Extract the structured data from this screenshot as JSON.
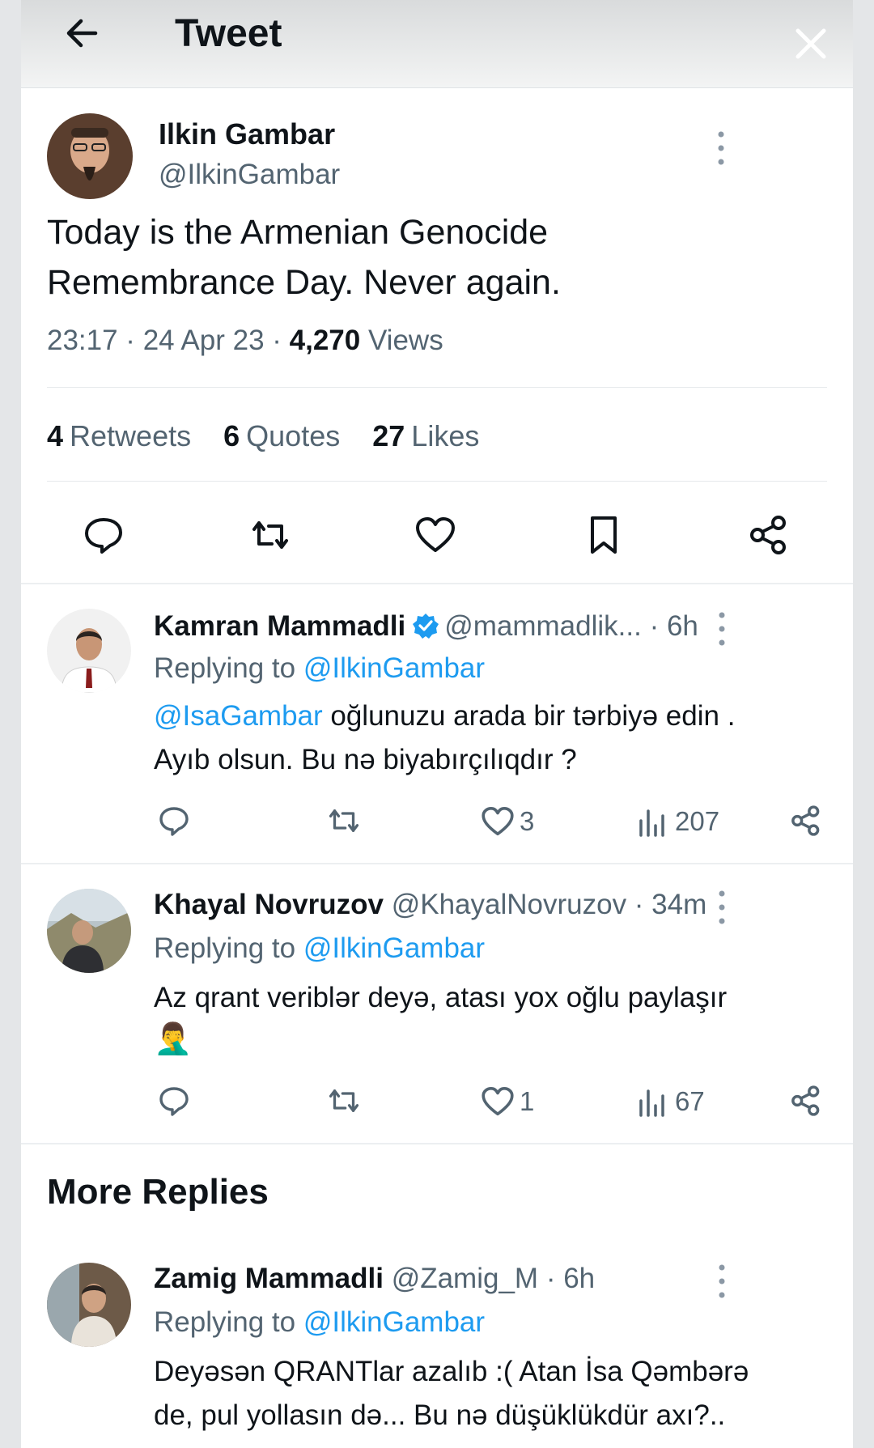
{
  "header": {
    "title": "Tweet"
  },
  "tweet": {
    "author_name": "Ilkin Gambar",
    "author_handle": "@IlkinGambar",
    "text_line1": "Today is the Armenian Genocide",
    "text_line2": "Remembrance Day. Never again.",
    "time": "23:17 · 24 Apr 23 · ",
    "views_count": "4,270",
    "views_label": " Views",
    "retweets_count": "4",
    "retweets_label": "Retweets",
    "quotes_count": "6",
    "quotes_label": "Quotes",
    "likes_count": "27",
    "likes_label": "Likes"
  },
  "replies": [
    {
      "name": "Kamran Mammadli",
      "handle": "@mammadlik...",
      "time": " · 6h",
      "replying_prefix": "Replying to ",
      "replying_to": "@IlkinGambar",
      "mention": "@IsaGambar",
      "text_line1": " oğlunuzu arada bir tərbiyə edin .",
      "text_line2": "Ayıb olsun. Bu nə biyabırçılıqdır ?",
      "likes": "3",
      "views": "207"
    },
    {
      "name": "Khayal Novruzov",
      "handle": "@KhayalNovruzov",
      "time": " · 34m",
      "replying_prefix": "Replying to ",
      "replying_to": "@IlkinGambar",
      "text_line1": "Az qrant veriblər deyə, atası yox oğlu paylaşır",
      "emoji": "🤦‍♂️",
      "likes": "1",
      "views": "67"
    }
  ],
  "more_replies": {
    "title": "More Replies",
    "items": [
      {
        "name": "Zamig Mammadli",
        "handle": "@Zamig_M",
        "time": " · 6h",
        "replying_prefix": "Replying to ",
        "replying_to": "@IlkinGambar",
        "text_line1": "Deyəsən QRANTlar azalıb :( Atan İsa Qəmbərə",
        "text_line2": "de, pul yollasın də... Bu nə düşüklükdür axı?.."
      }
    ]
  },
  "icons": {
    "back": "arrow-left-icon",
    "close": "close-icon",
    "more": "more-vertical-icon",
    "reply": "reply-icon",
    "retweet": "retweet-icon",
    "like": "heart-icon",
    "bookmark": "bookmark-icon",
    "share": "share-icon",
    "views": "views-icon",
    "verified": "verified-badge-icon"
  },
  "colors": {
    "link": "#1d9bf0",
    "secondary_text": "#536471",
    "primary_text": "#0f1419"
  }
}
